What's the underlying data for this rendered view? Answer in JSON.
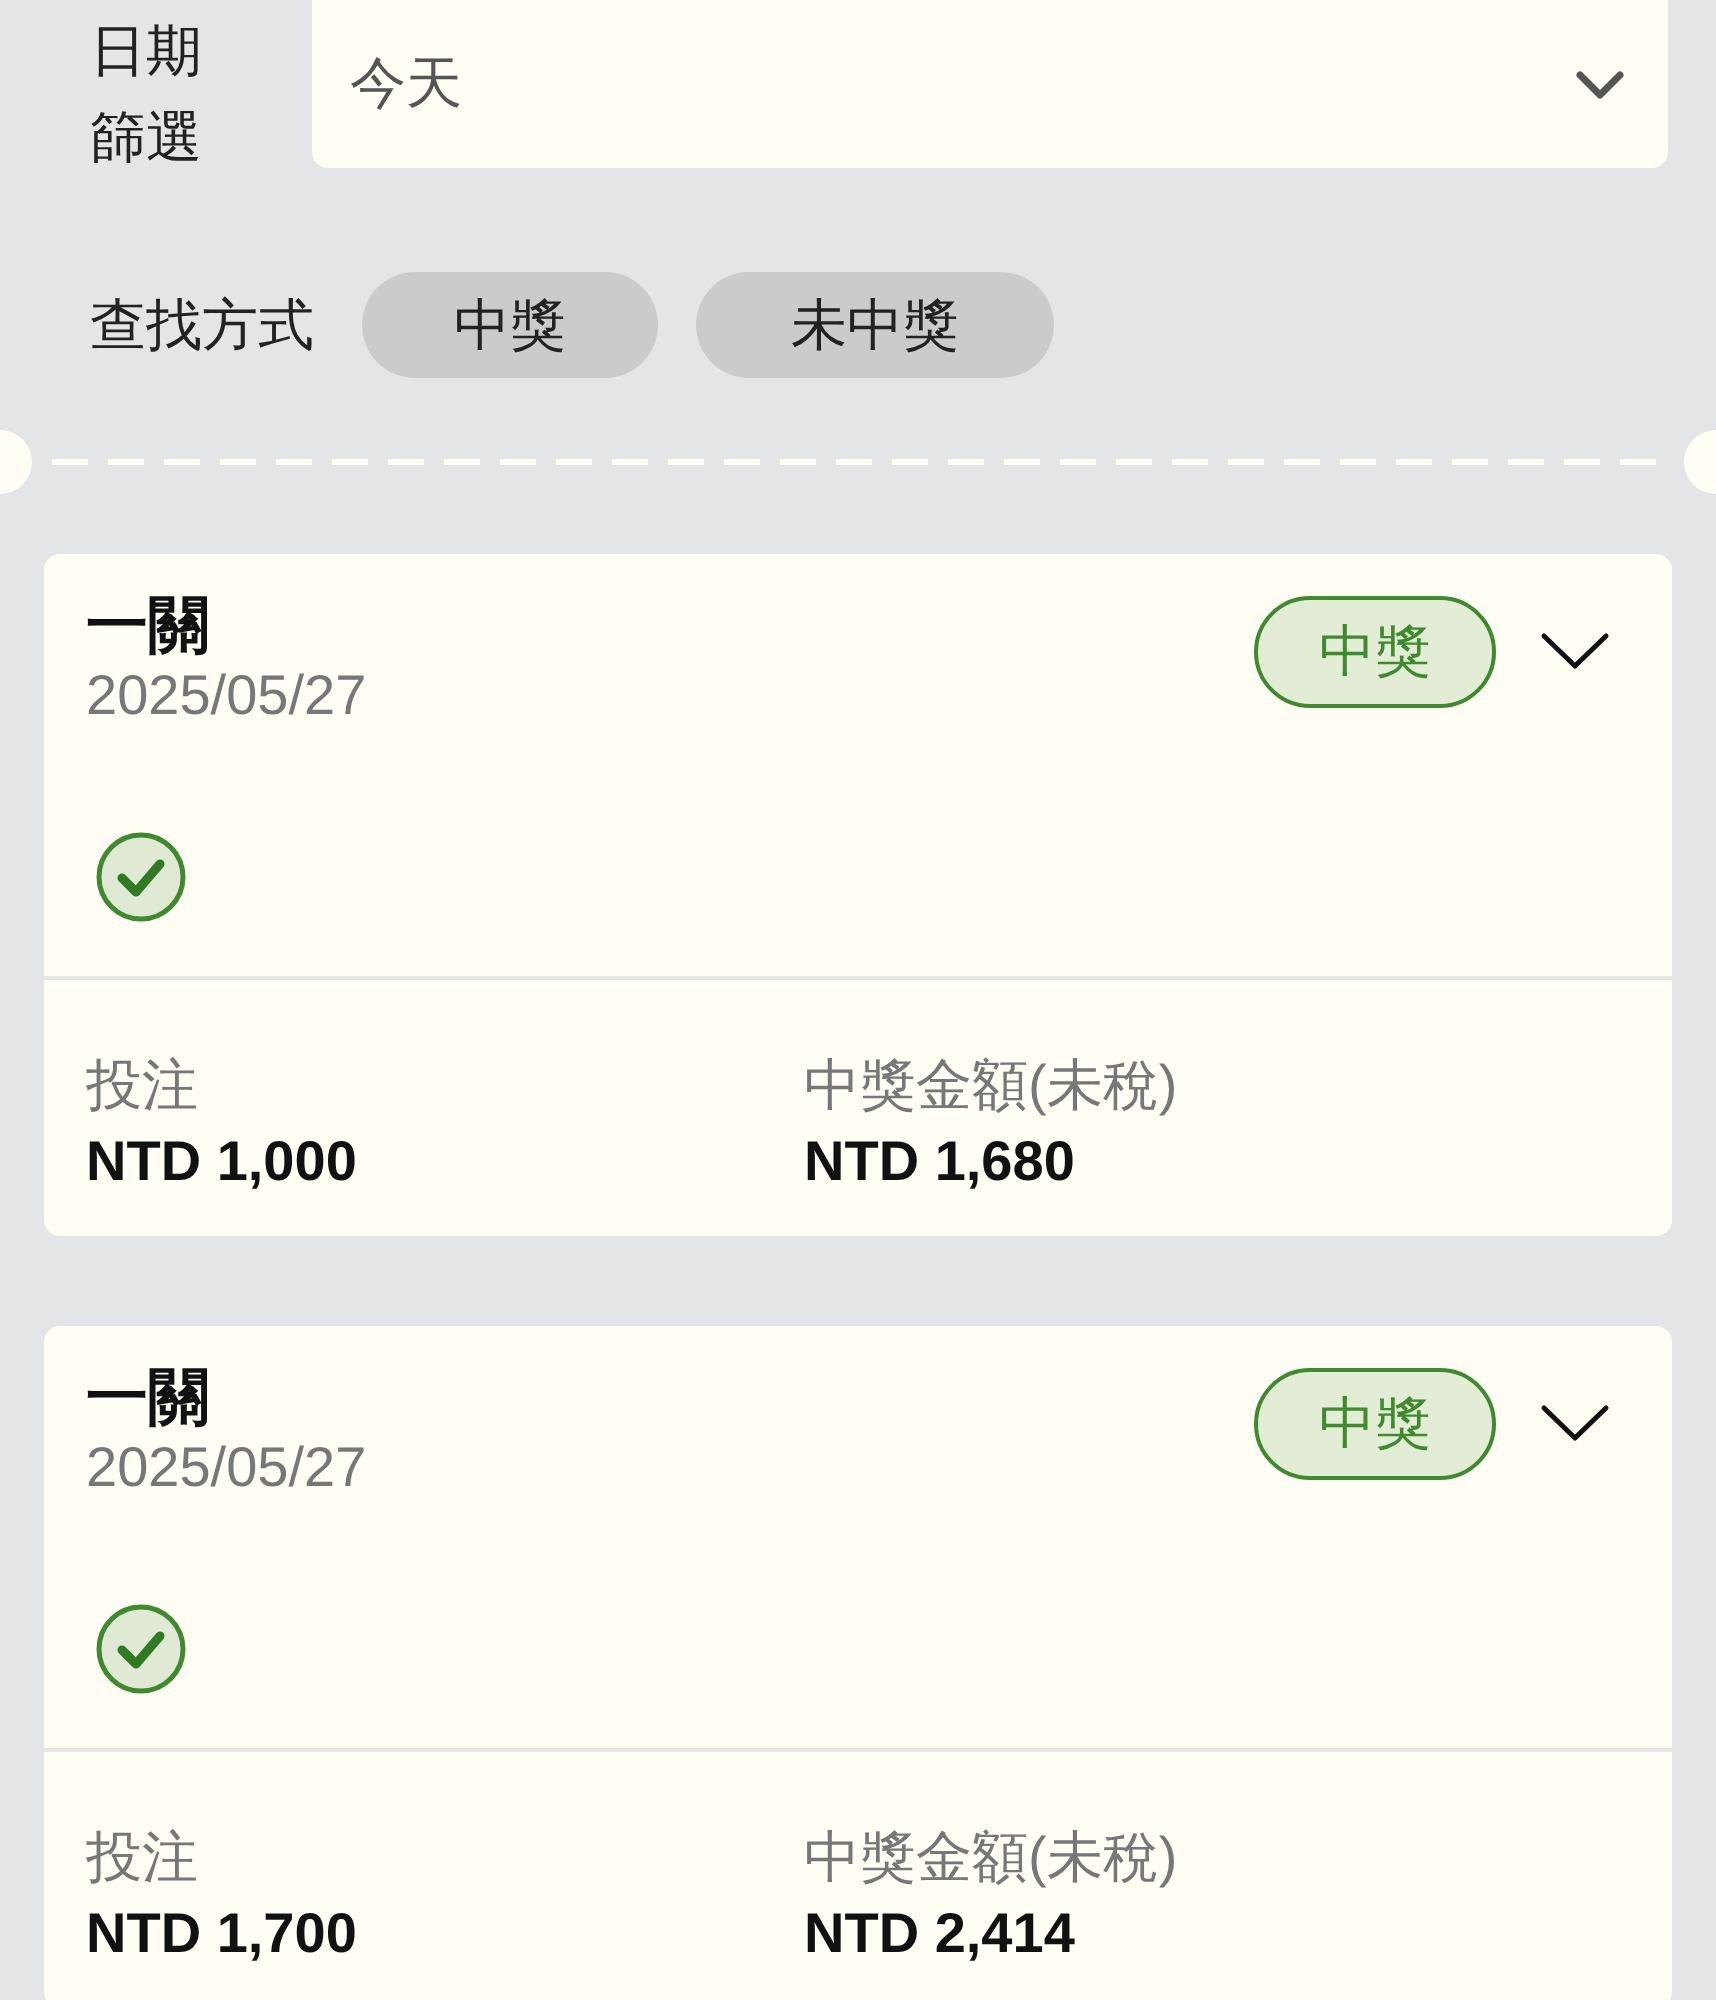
{
  "date_filter": {
    "label": "日期篩選",
    "value": "今天"
  },
  "search_mode": {
    "label": "查找方式",
    "options": [
      {
        "label": "中獎",
        "selected": false
      },
      {
        "label": "未中獎",
        "selected": false
      }
    ]
  },
  "records": [
    {
      "title": "一關",
      "date": "2025/05/27",
      "status": {
        "label": "中獎",
        "kind": "won"
      },
      "stake_label": "投注",
      "stake": "NTD 1,000",
      "payout_label": "中獎金額(未稅)",
      "payout": "NTD 1,680"
    },
    {
      "title": "一關",
      "date": "2025/05/27",
      "status": {
        "label": "中獎",
        "kind": "won"
      },
      "stake_label": "投注",
      "stake": "NTD 1,700",
      "payout_label": "中獎金額(未稅)",
      "payout": "NTD 2,414"
    }
  ]
}
